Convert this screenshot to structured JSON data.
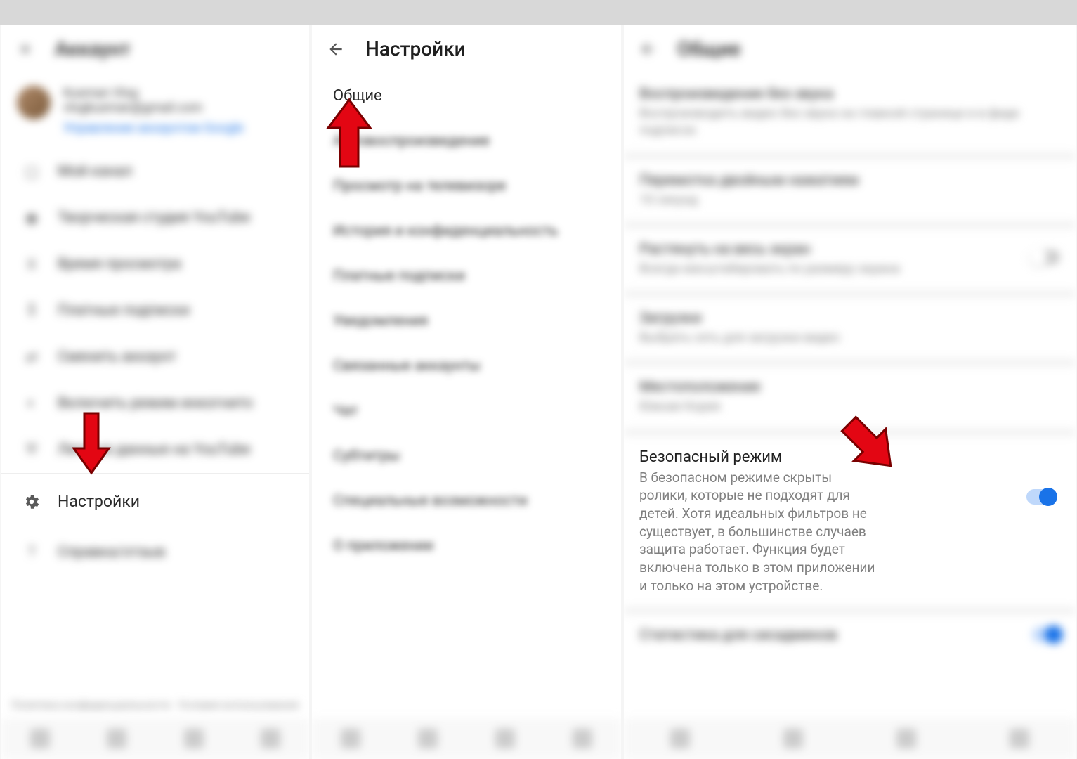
{
  "status_bar": {},
  "panel1": {
    "title": "Аккаунт",
    "account": {
      "name": "Kusman Vlog",
      "email": "vlogkusman@gmail.com",
      "manage_link": "Управление аккаунтом Google"
    },
    "items": [
      "Мой канал",
      "Творческая студия YouTube",
      "Время просмотра",
      "Платные подписки",
      "Сменить аккаунт",
      "Включить режим инкогнито",
      "Личные данные на YouTube"
    ],
    "settings_label": "Настройки",
    "help_label": "Справка/отзыв",
    "footer": "Политика конфиденциальности · Условия использования"
  },
  "panel2": {
    "title": "Настройки",
    "general_label": "Общие",
    "items": [
      "Автовоспроизведение",
      "Просмотр на телевизоре",
      "История и конфиденциальность",
      "Платные подписки",
      "Уведомления",
      "Связанные аккаунты",
      "Чат",
      "Субтитры",
      "Специальные возможности",
      "О приложении"
    ]
  },
  "panel3": {
    "title": "Общие",
    "rows": [
      {
        "title": "Воспроизведение без звука",
        "desc": "Воспроизводить видео без звука на главной странице и в фиде подписок"
      },
      {
        "title": "Перемотка двойным нажатием",
        "desc": "10 секунд"
      },
      {
        "title": "Растянуть на весь экран",
        "desc": "Всегда масштабировать по размеру экрана",
        "toggle": "off"
      },
      {
        "title": "Загрузки",
        "desc": "Выбрать сеть для загрузки видео"
      },
      {
        "title": "Местоположение",
        "desc": "Южная Корея"
      }
    ],
    "safe_mode": {
      "title": "Безопасный режим",
      "desc": "В безопасном режиме скрыты ролики, которые не подходят для детей. Хотя идеальных фильтров не существует, в большинстве случаев защита работает. Функция будет включена только в этом приложении и только на этом устройстве."
    },
    "stats_row": {
      "title": "Статистика для сисадминов"
    }
  }
}
